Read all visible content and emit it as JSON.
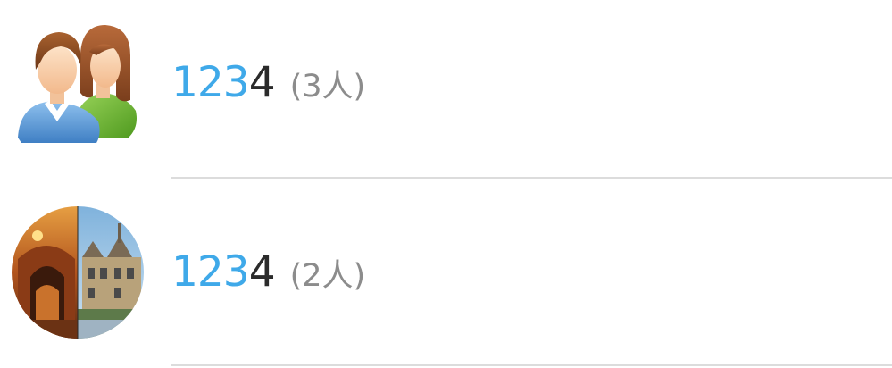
{
  "groups": [
    {
      "name_highlight": "123",
      "name_rest": "4",
      "member_count": "(3人)",
      "avatar_icon": "group-people-icon"
    },
    {
      "name_highlight": "123",
      "name_rest": "4",
      "member_count": "(2人)",
      "avatar_icon": "group-photo-avatar"
    }
  ],
  "colors": {
    "highlight": "#3fa9e9",
    "name": "#2b2b2b",
    "count": "#8c8c8c",
    "divider": "#dcdcdc"
  }
}
